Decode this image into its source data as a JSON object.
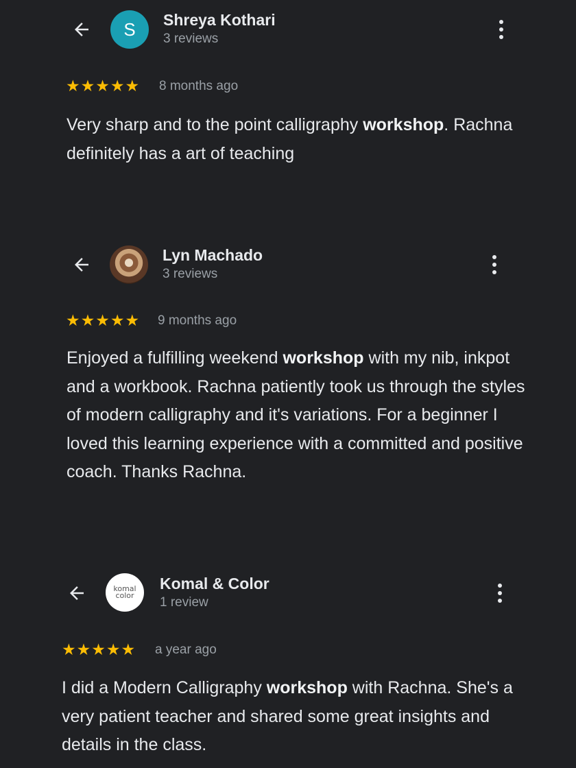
{
  "reviews": [
    {
      "avatar_letter": "S",
      "author": "Shreya Kothari",
      "review_count": "3 reviews",
      "rating": 5,
      "age": "8 months ago",
      "text_parts": [
        "Very sharp and to the point calligraphy ",
        "workshop",
        ". Rachna definitely has a art of teaching"
      ]
    },
    {
      "avatar_icon": "profile-photo",
      "author": "Lyn Machado",
      "review_count": "3 reviews",
      "rating": 5,
      "age": "9 months ago",
      "text_parts": [
        "Enjoyed a fulfilling weekend ",
        "workshop",
        " with my nib, inkpot and a workbook. Rachna patiently took us through the styles of modern calligraphy and it's variations. For a beginner I loved this learning experience with a committed and positive coach. Thanks Rachna."
      ]
    },
    {
      "avatar_logo": [
        "komal",
        "color"
      ],
      "author": "Komal & Color",
      "review_count": "1 review",
      "rating": 5,
      "age": "a year ago",
      "text_parts": [
        "I did a Modern Calligraphy ",
        "workshop",
        " with Rachna. She's a very patient teacher and shared some great insights and details in the class."
      ]
    }
  ],
  "icons": {
    "back": "arrow-left-icon",
    "menu": "more-vertical-icon",
    "star": "star-icon"
  },
  "colors": {
    "background": "#202124",
    "star": "#fbbc04",
    "avatar_letter_bg": "#1a9fb3",
    "secondary_text": "#9aa0a6"
  }
}
